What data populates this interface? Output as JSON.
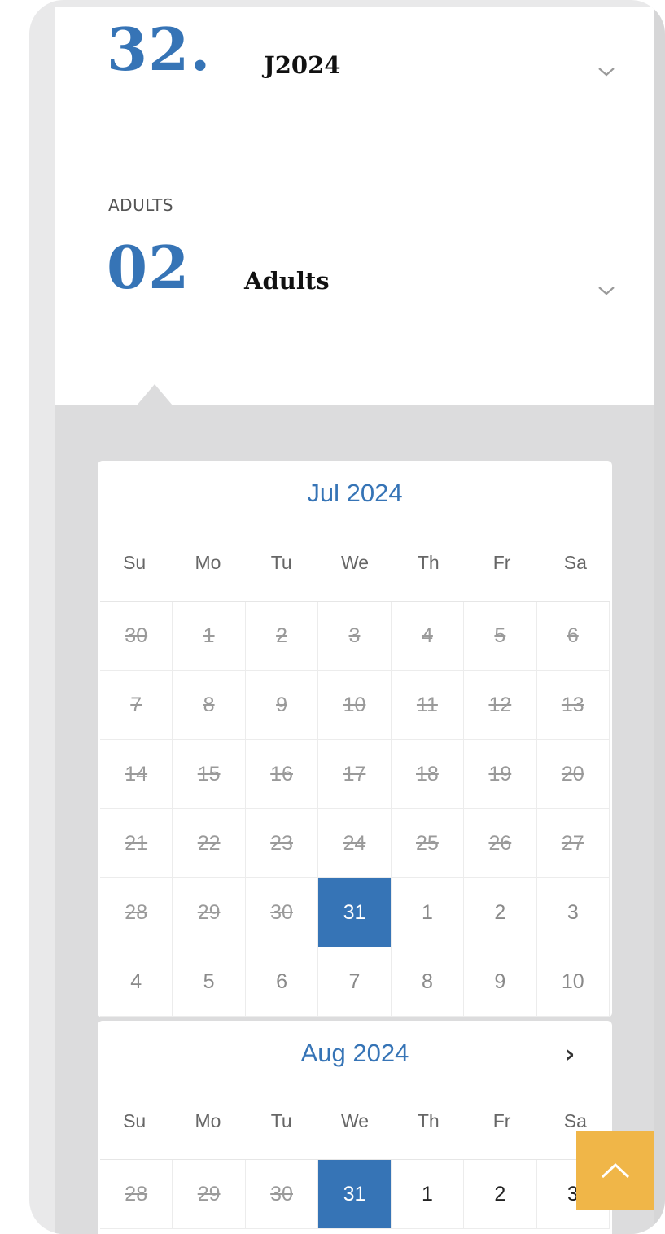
{
  "date_field": {
    "number": "32.",
    "label": "J2024"
  },
  "adults_field": {
    "caption": "ADULTS",
    "number": "02",
    "label": "Adults"
  },
  "weekdays": [
    "Su",
    "Mo",
    "Tu",
    "We",
    "Th",
    "Fr",
    "Sa"
  ],
  "july": {
    "title": "Jul 2024",
    "days": [
      {
        "d": "30",
        "s": "dis"
      },
      {
        "d": "1",
        "s": "dis"
      },
      {
        "d": "2",
        "s": "dis"
      },
      {
        "d": "3",
        "s": "dis"
      },
      {
        "d": "4",
        "s": "dis"
      },
      {
        "d": "5",
        "s": "dis"
      },
      {
        "d": "6",
        "s": "dis"
      },
      {
        "d": "7",
        "s": "dis"
      },
      {
        "d": "8",
        "s": "dis"
      },
      {
        "d": "9",
        "s": "dis"
      },
      {
        "d": "10",
        "s": "dis"
      },
      {
        "d": "11",
        "s": "dis"
      },
      {
        "d": "12",
        "s": "dis"
      },
      {
        "d": "13",
        "s": "dis"
      },
      {
        "d": "14",
        "s": "dis"
      },
      {
        "d": "15",
        "s": "dis"
      },
      {
        "d": "16",
        "s": "dis"
      },
      {
        "d": "17",
        "s": "dis"
      },
      {
        "d": "18",
        "s": "dis"
      },
      {
        "d": "19",
        "s": "dis"
      },
      {
        "d": "20",
        "s": "dis"
      },
      {
        "d": "21",
        "s": "dis"
      },
      {
        "d": "22",
        "s": "dis"
      },
      {
        "d": "23",
        "s": "dis"
      },
      {
        "d": "24",
        "s": "dis"
      },
      {
        "d": "25",
        "s": "dis"
      },
      {
        "d": "26",
        "s": "dis"
      },
      {
        "d": "27",
        "s": "dis"
      },
      {
        "d": "28",
        "s": "dis"
      },
      {
        "d": "29",
        "s": "dis"
      },
      {
        "d": "30",
        "s": "dis"
      },
      {
        "d": "31",
        "s": "sel"
      },
      {
        "d": "1",
        "s": "muted"
      },
      {
        "d": "2",
        "s": "muted"
      },
      {
        "d": "3",
        "s": "muted"
      },
      {
        "d": "4",
        "s": "muted"
      },
      {
        "d": "5",
        "s": "muted"
      },
      {
        "d": "6",
        "s": "muted"
      },
      {
        "d": "7",
        "s": "muted"
      },
      {
        "d": "8",
        "s": "muted"
      },
      {
        "d": "9",
        "s": "muted"
      },
      {
        "d": "10",
        "s": "muted"
      }
    ]
  },
  "august": {
    "title": "Aug 2024",
    "next_icon": "chevron-right-icon",
    "days": [
      {
        "d": "28",
        "s": "dis"
      },
      {
        "d": "29",
        "s": "dis"
      },
      {
        "d": "30",
        "s": "dis"
      },
      {
        "d": "31",
        "s": "sel"
      },
      {
        "d": "1",
        "s": "active"
      },
      {
        "d": "2",
        "s": "active"
      },
      {
        "d": "3",
        "s": "active"
      }
    ]
  },
  "colors": {
    "accent": "#3674b6",
    "scroll_button": "#f0b648"
  }
}
